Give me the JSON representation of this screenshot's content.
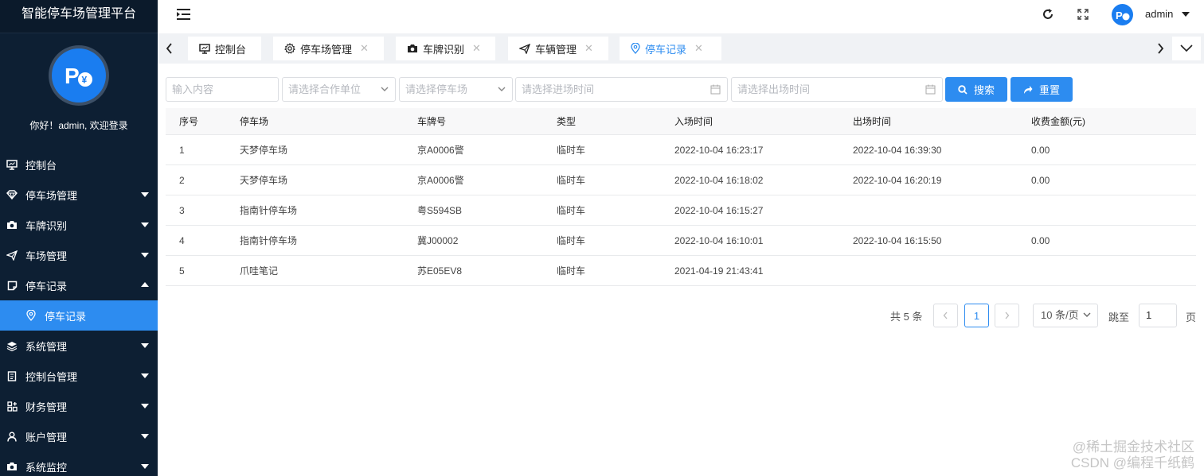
{
  "sidebar": {
    "title": "智能停车场管理平台",
    "welcome": "你好！admin, 欢迎登录",
    "items": [
      {
        "label": "控制台",
        "icon": "monitor-icon",
        "caret": "none"
      },
      {
        "label": "停车场管理",
        "icon": "diamond-icon",
        "caret": "down"
      },
      {
        "label": "车牌识别",
        "icon": "camera-icon",
        "caret": "down"
      },
      {
        "label": "车场管理",
        "icon": "send-icon",
        "caret": "down"
      },
      {
        "label": "停车记录",
        "icon": "note-icon",
        "caret": "up"
      },
      {
        "label": "停车记录",
        "icon": "location-icon",
        "caret": "none",
        "sub": true
      },
      {
        "label": "系统管理",
        "icon": "layers-icon",
        "caret": "down"
      },
      {
        "label": "控制台管理",
        "icon": "clipboard-icon",
        "caret": "down"
      },
      {
        "label": "财务管理",
        "icon": "apps-icon",
        "caret": "down"
      },
      {
        "label": "账户管理",
        "icon": "user-icon",
        "caret": "down"
      },
      {
        "label": "系统监控",
        "icon": "camera-icon",
        "caret": "down"
      }
    ]
  },
  "header": {
    "user": "admin"
  },
  "tabs": [
    {
      "label": "控制台",
      "icon": "monitor-icon",
      "closable": false,
      "active": false
    },
    {
      "label": "停车场管理",
      "icon": "gear-icon",
      "closable": true,
      "active": false
    },
    {
      "label": "车牌识别",
      "icon": "camera-icon",
      "closable": true,
      "active": false
    },
    {
      "label": "车辆管理",
      "icon": "send-icon",
      "closable": true,
      "active": false
    },
    {
      "label": "停车记录",
      "icon": "location-icon",
      "closable": true,
      "active": true
    }
  ],
  "filters": {
    "keyword_placeholder": "输入内容",
    "partner_placeholder": "请选择合作单位",
    "parking_placeholder": "请选择停车场",
    "entry_time_placeholder": "请选择进场时间",
    "exit_time_placeholder": "请选择出场时间",
    "search_label": "搜索",
    "reset_label": "重置"
  },
  "table": {
    "columns": [
      "序号",
      "停车场",
      "车牌号",
      "类型",
      "入场时间",
      "出场时间",
      "收费金额(元)"
    ],
    "rows": [
      [
        "1",
        "天梦停车场",
        "京A0006警",
        "临时车",
        "2022-10-04 16:23:17",
        "2022-10-04 16:39:30",
        "0.00"
      ],
      [
        "2",
        "天梦停车场",
        "京A0006警",
        "临时车",
        "2022-10-04 16:18:02",
        "2022-10-04 16:20:19",
        "0.00"
      ],
      [
        "3",
        "指南针停车场",
        "粤S594SB",
        "临时车",
        "2022-10-04 16:15:27",
        "",
        ""
      ],
      [
        "4",
        "指南针停车场",
        "冀J00002",
        "临时车",
        "2022-10-04 16:10:01",
        "2022-10-04 16:15:50",
        "0.00"
      ],
      [
        "5",
        "爪哇笔记",
        "苏E05EV8",
        "临时车",
        "2021-04-19 21:43:41",
        "",
        ""
      ]
    ]
  },
  "pagination": {
    "total": "共 5 条",
    "current": "1",
    "page_size": "10 条/页",
    "jump_label": "跳至",
    "jump_value": "1",
    "page_label": "页"
  },
  "watermark": {
    "line1": "@稀土掘金技术社区",
    "line2": "CSDN @编程千纸鹤"
  },
  "colors": {
    "sidebar_bg": "#0d1f33",
    "accent": "#2d8cf0"
  }
}
